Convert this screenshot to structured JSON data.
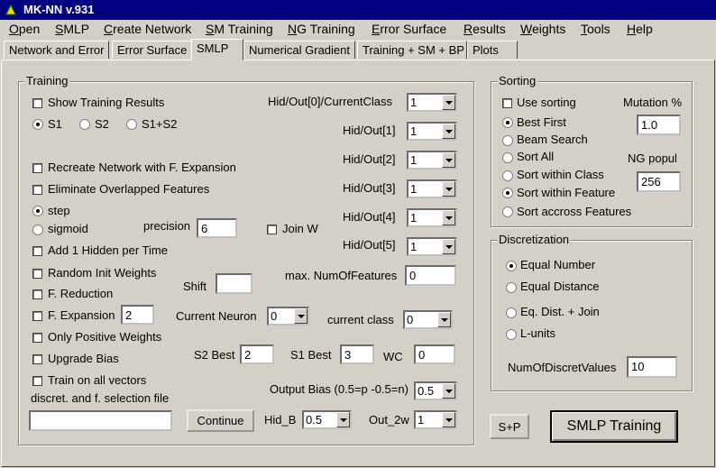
{
  "window": {
    "title": "MK-NN    v.931"
  },
  "menu": [
    {
      "label": "Open",
      "ul": "O",
      "rest": "pen"
    },
    {
      "label": "SMLP",
      "ul": "S",
      "rest": "MLP"
    },
    {
      "label": "Create Network",
      "ul": "C",
      "rest": "reate Network"
    },
    {
      "label": "SM Training",
      "ul": "S",
      "rest": "M Training"
    },
    {
      "label": "NG Training",
      "ul": "N",
      "rest": "G Training"
    },
    {
      "label": "Error Surface",
      "ul": "E",
      "rest": "rror Surface"
    },
    {
      "label": "Results",
      "ul": "R",
      "rest": "esults"
    },
    {
      "label": "Weights",
      "ul": "W",
      "rest": "eights"
    },
    {
      "label": "Tools",
      "ul": "T",
      "rest": "ools"
    },
    {
      "label": "Help",
      "ul": "H",
      "rest": "elp"
    }
  ],
  "tabs": [
    "Network and Error",
    "Error Surface",
    "SMLP",
    "Numerical Gradient",
    "Training + SM + BP",
    "Plots"
  ],
  "training": {
    "title": "Training",
    "show_results": "Show Training Results",
    "s1": "S1",
    "s2": "S2",
    "s1s2": "S1+S2",
    "recreate": "Recreate Network with F. Expansion",
    "eliminate": "Eliminate Overlapped Features",
    "step": "step",
    "sigmoid": "sigmoid",
    "precision_label": "precision",
    "precision_value": "6",
    "join_w": "Join W",
    "add_hidden": "Add 1 Hidden per Time",
    "random_init": "Random Init Weights",
    "f_reduction": "F. Reduction",
    "shift_label": "Shift",
    "shift_value": "",
    "f_expansion": "F. Expansion",
    "f_expansion_value": "2",
    "only_positive": "Only Positive Weights",
    "upgrade_bias": "Upgrade Bias",
    "train_all": "Train on all vectors",
    "file_label": "discret. and f. selection file",
    "file_value": "",
    "continue": "Continue",
    "hid_out_0": "Hid/Out[0]/CurrentClass",
    "hid_out_0_value": "1",
    "hid_out_1": "Hid/Out[1]",
    "hid_out_1_value": "1",
    "hid_out_2": "Hid/Out[2]",
    "hid_out_2_value": "1",
    "hid_out_3": "Hid/Out[3]",
    "hid_out_3_value": "1",
    "hid_out_4": "Hid/Out[4]",
    "hid_out_4_value": "1",
    "hid_out_5": "Hid/Out[5]",
    "hid_out_5_value": "1",
    "max_features_label": "max. NumOfFeatures",
    "max_features_value": "0",
    "current_neuron_label": "Current Neuron",
    "current_neuron_value": "0",
    "current_class_label": "current class",
    "current_class_value": "0",
    "s2best_label": "S2 Best",
    "s2best_value": "2",
    "s1best_label": "S1 Best",
    "s1best_value": "3",
    "wc_label": "WC",
    "wc_value": "0",
    "output_bias_label": "Output Bias (0.5=p  -0.5=n)",
    "output_bias_value": "0.5",
    "hid_b_label": "Hid_B",
    "hid_b_value": "0.5",
    "out_2w_label": "Out_2w",
    "out_2w_value": "1"
  },
  "sorting": {
    "title": "Sorting",
    "use_sorting": "Use sorting",
    "mutation_label": "Mutation %",
    "mutation_value": "1.0",
    "best_first": "Best First",
    "beam_search": "Beam Search",
    "sort_all": "Sort All",
    "ng_popul_label": "NG popul",
    "ng_popul_value": "256",
    "within_class": "Sort within Class",
    "within_feature": "Sort within Feature",
    "across_features": "Sort accross Features"
  },
  "discretization": {
    "title": "Discretization",
    "equal_number": "Equal Number",
    "equal_distance": "Equal Distance",
    "eq_dist_join": "Eq. Dist. + Join",
    "l_units": "L-units",
    "num_values_label": "NumOfDiscretValues",
    "num_values_value": "10"
  },
  "buttons": {
    "sp": "S+P",
    "smlp_training": "SMLP Training"
  }
}
